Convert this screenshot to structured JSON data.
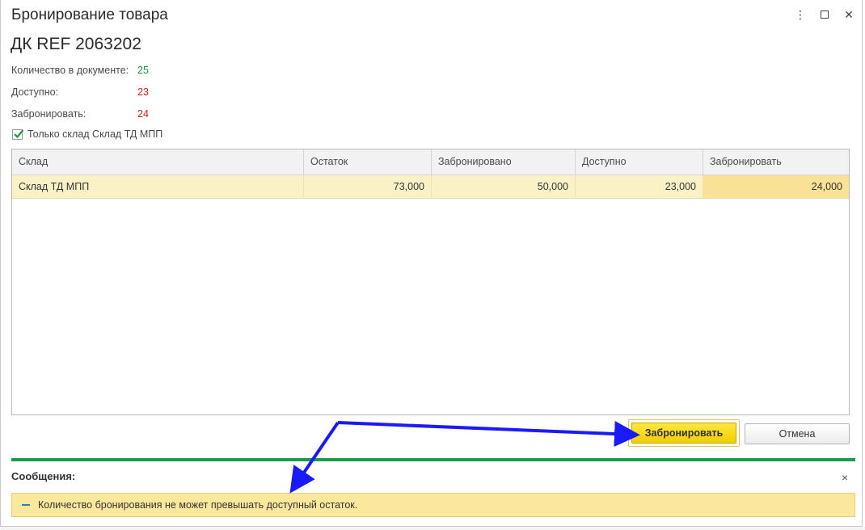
{
  "window": {
    "title": "Бронирование товара",
    "controls": {
      "more": "⋮",
      "maximize": "",
      "close": "✕"
    }
  },
  "document": {
    "title": "ДК REF 2063202"
  },
  "fields": [
    {
      "label": "Количество в документе:",
      "value": "25",
      "color": "#1a8f3c"
    },
    {
      "label": "Доступно:",
      "value": "23",
      "color": "#d11c1c"
    },
    {
      "label": "Забронировать:",
      "value": "24",
      "color": "#d11c1c"
    }
  ],
  "checkbox": {
    "label": "Только склад Склад ТД МПП",
    "checked": true
  },
  "table": {
    "columns": [
      "Склад",
      "Остаток",
      "Забронировано",
      "Доступно",
      "Забронировать"
    ],
    "rows": [
      [
        "Склад ТД МПП",
        "73,000",
        "50,000",
        "23,000",
        "24,000"
      ]
    ]
  },
  "buttons": {
    "reserve": "Забронировать",
    "cancel": "Отмена"
  },
  "messages": {
    "title": "Сообщения:",
    "close": "×",
    "items": [
      "Количество бронирования не может превышать доступный остаток."
    ]
  },
  "colors": {
    "accent_green": "#1a9a4a",
    "primary_button": "#f2cf00",
    "row_highlight": "#fbf1c7",
    "message_bg": "#fbe89c",
    "annotation_arrow": "#1a1aff"
  }
}
